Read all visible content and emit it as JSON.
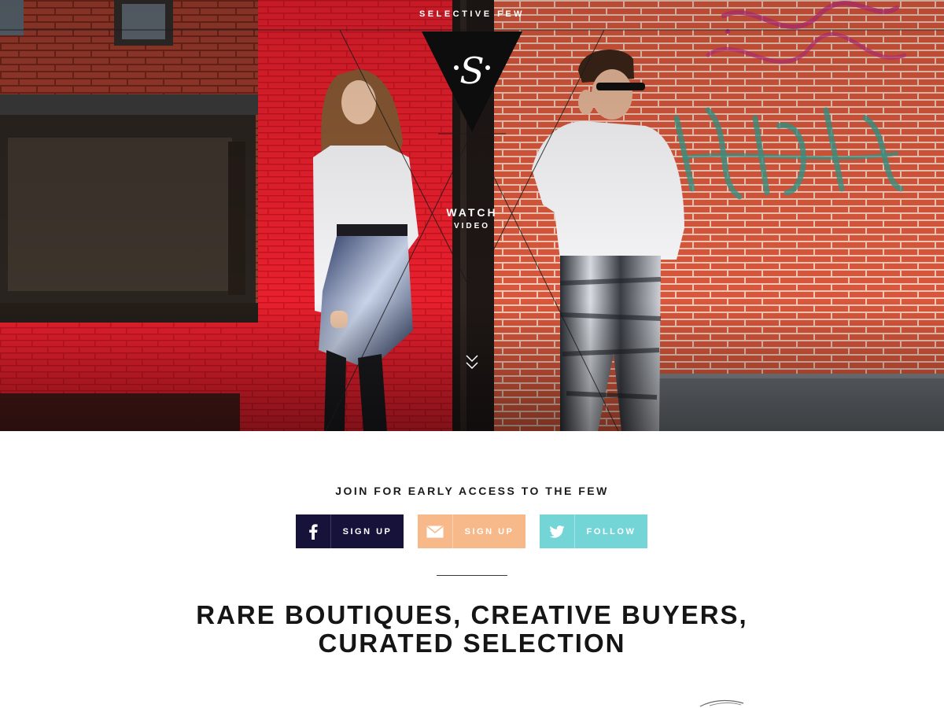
{
  "hero": {
    "brand": "SELECTIVE FEW",
    "logo_letter": "S",
    "watch_label": "WATCH",
    "video_label": "VIDEO"
  },
  "signup": {
    "heading": "JOIN FOR EARLY ACCESS TO THE FEW",
    "buttons": [
      {
        "icon": "facebook-icon",
        "label": "SIGN UP",
        "color": "#16123a"
      },
      {
        "icon": "mail-icon",
        "label": "SIGN UP",
        "color": "#f8b98a"
      },
      {
        "icon": "twitter-icon",
        "label": "FOLLOW",
        "color": "#74d5d7"
      }
    ]
  },
  "tagline": {
    "line1": "RARE BOUTIQUES, CREATIVE BUYERS,",
    "line2": "CURATED SELECTION"
  }
}
